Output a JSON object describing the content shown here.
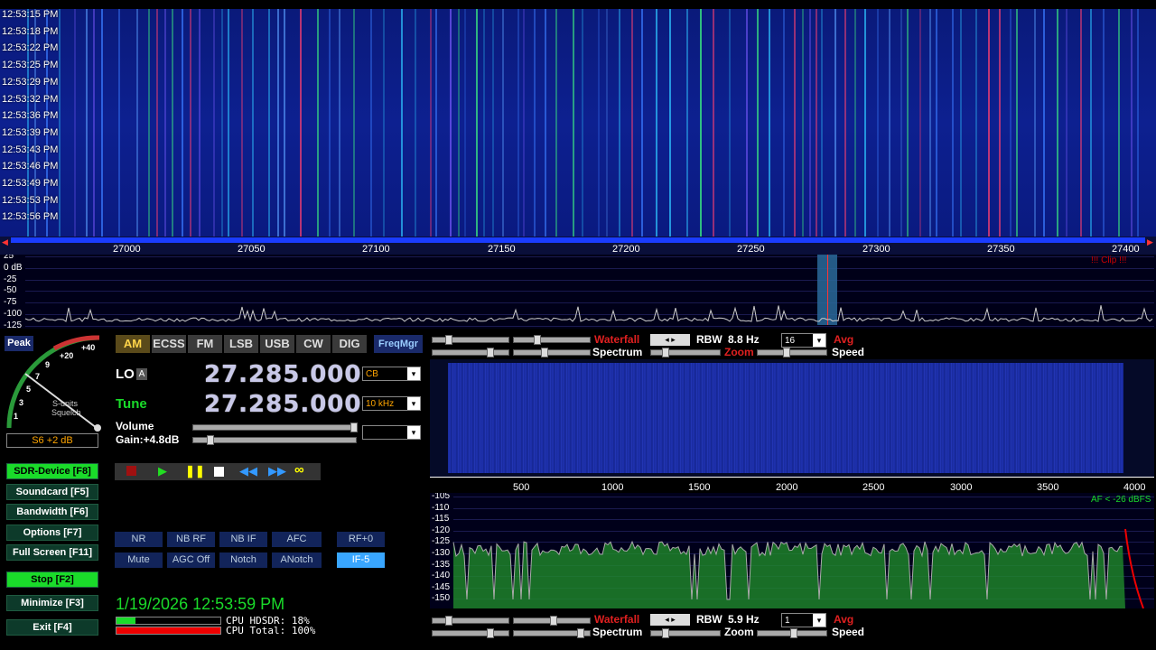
{
  "waterfall": {
    "times": [
      "12:53:15 PM",
      "12:53:18 PM",
      "12:53:22 PM",
      "12:53:25 PM",
      "12:53:29 PM",
      "12:53:32 PM",
      "12:53:36 PM",
      "12:53:39 PM",
      "12:53:43 PM",
      "12:53:46 PM",
      "12:53:49 PM",
      "12:53:53 PM",
      "12:53:56 PM"
    ],
    "freq_ticks": [
      "27000",
      "27050",
      "27100",
      "27150",
      "27200",
      "27250",
      "27300",
      "27350",
      "27400"
    ]
  },
  "rf_spectrum": {
    "db_labels": [
      "25",
      "0 dB",
      "-25",
      "-50",
      "-75",
      "-100",
      "-125"
    ],
    "clip_text": "!!! Clip !!!"
  },
  "smeter": {
    "peak_label": "Peak",
    "reading": "S6 +2 dB",
    "scale_labels": [
      "+40",
      "+20",
      "9",
      "7",
      "5",
      "3",
      "1"
    ],
    "s_units_label": "S-units",
    "squelch_label": "Squelch"
  },
  "modes": {
    "items": [
      "AM",
      "ECSS",
      "FM",
      "LSB",
      "USB",
      "CW",
      "DIG"
    ],
    "selected": "AM",
    "freqmgr": "FreqMgr"
  },
  "lo": {
    "label": "LO",
    "badge": "A",
    "freq": "27.285.000",
    "band": "CB"
  },
  "tune": {
    "label": "Tune",
    "freq": "27.285.000",
    "step": "10 kHz"
  },
  "volume": {
    "label": "Volume",
    "gain": "Gain:+4.8dB"
  },
  "left_buttons": [
    "SDR-Device [F8]",
    "Soundcard [F5]",
    "Bandwidth [F6]",
    "Options [F7]",
    "Full Screen [F11]",
    "Stop [F2]",
    "Minimize [F3]",
    "Exit [F4]"
  ],
  "dsp_row1": [
    "NR",
    "NB RF",
    "NB IF",
    "AFC",
    "RF+0"
  ],
  "dsp_row2": [
    "Mute",
    "AGC Off",
    "Notch",
    "ANotch",
    "IF-5"
  ],
  "datetime": "1/19/2026 12:53:59 PM",
  "cpu": {
    "hdsdr": "CPU HDSDR: 18%",
    "total": "CPU Total: 100%"
  },
  "top_controls": {
    "waterfall": "Waterfall",
    "spectrum": "Spectrum",
    "rbw_label": "RBW",
    "rbw_value": "8.8 Hz",
    "avg_value": "16",
    "avg": "Avg",
    "zoom": "Zoom",
    "speed": "Speed"
  },
  "af_ticks": [
    "500",
    "1000",
    "1500",
    "2000",
    "2500",
    "3000",
    "3500",
    "4000"
  ],
  "af_db": [
    "-105",
    "-110",
    "-115",
    "-120",
    "-125",
    "-130",
    "-135",
    "-140",
    "-145",
    "-150"
  ],
  "af_level": "AF < -26 dBFS",
  "bottom_controls": {
    "waterfall": "Waterfall",
    "spectrum": "Spectrum",
    "rbw_label": "RBW",
    "rbw_value": "5.9 Hz",
    "avg_value": "1",
    "avg": "Avg",
    "zoom": "Zoom",
    "speed": "Speed"
  },
  "colors": {
    "accent_green": "#1adb2a",
    "freq_text": "#c8c8e8",
    "waterfall_bg": "#0d2090",
    "warning_red": "#ff2020"
  }
}
